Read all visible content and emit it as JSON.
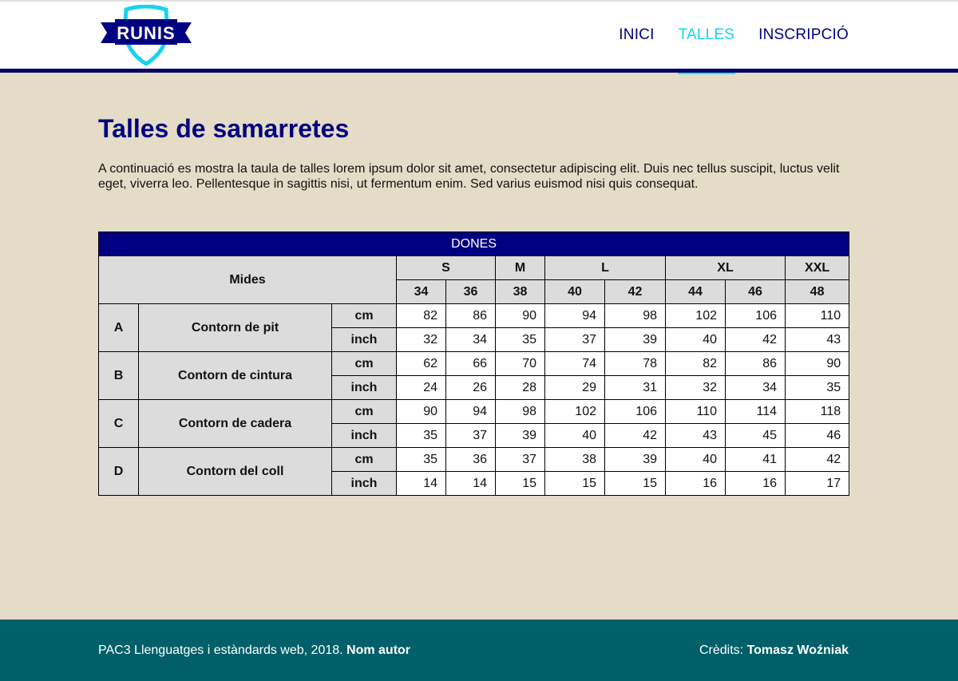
{
  "brand": {
    "logo_text": "RUNIS"
  },
  "nav": {
    "items": [
      {
        "label": "INICI",
        "active": false
      },
      {
        "label": "TALLES",
        "active": true
      },
      {
        "label": "INSCRIPCIÓ",
        "active": false
      }
    ]
  },
  "main": {
    "title": "Talles de samarretes",
    "intro": "A continuació es mostra la taula de talles lorem ipsum dolor sit amet, consectetur adipiscing elit. Duis nec tellus suscipit, luctus velit eget, viverra leo. Pellentesque in sagittis nisi, ut fermentum enim. Sed varius euismod nisi quis consequat."
  },
  "table": {
    "group": "DONES",
    "mides_label": "Mides",
    "sizes": [
      {
        "label": "S",
        "span": 2
      },
      {
        "label": "M",
        "span": 1
      },
      {
        "label": "L",
        "span": 2
      },
      {
        "label": "XL",
        "span": 2
      },
      {
        "label": "XXL",
        "span": 1
      }
    ],
    "numbers": [
      "34",
      "36",
      "38",
      "40",
      "42",
      "44",
      "46",
      "48"
    ],
    "units": {
      "cm": "cm",
      "inch": "inch"
    },
    "rows": [
      {
        "letter": "A",
        "name": "Contorn de pit",
        "cm": [
          "82",
          "86",
          "90",
          "94",
          "98",
          "102",
          "106",
          "110"
        ],
        "inch": [
          "32",
          "34",
          "35",
          "37",
          "39",
          "40",
          "42",
          "43"
        ]
      },
      {
        "letter": "B",
        "name": "Contorn de cintura",
        "cm": [
          "62",
          "66",
          "70",
          "74",
          "78",
          "82",
          "86",
          "90"
        ],
        "inch": [
          "24",
          "26",
          "28",
          "29",
          "31",
          "32",
          "34",
          "35"
        ]
      },
      {
        "letter": "C",
        "name": "Contorn de cadera",
        "cm": [
          "90",
          "94",
          "98",
          "102",
          "106",
          "110",
          "114",
          "118"
        ],
        "inch": [
          "35",
          "37",
          "39",
          "40",
          "42",
          "43",
          "45",
          "46"
        ]
      },
      {
        "letter": "D",
        "name": "Contorn del coll",
        "cm": [
          "35",
          "36",
          "37",
          "38",
          "39",
          "40",
          "41",
          "42"
        ],
        "inch": [
          "14",
          "14",
          "15",
          "15",
          "15",
          "16",
          "16",
          "17"
        ]
      }
    ]
  },
  "footer": {
    "left_text": "PAC3 Llenguatges i estàndards web, 2018. ",
    "author": "Nom autor",
    "credits_label": "Crèdits: ",
    "credits_name": "Tomasz Woźniak"
  },
  "colors": {
    "navy": "#000080",
    "accent": "#19d3ec",
    "background": "#e4dcc7",
    "footer": "#005f69"
  }
}
